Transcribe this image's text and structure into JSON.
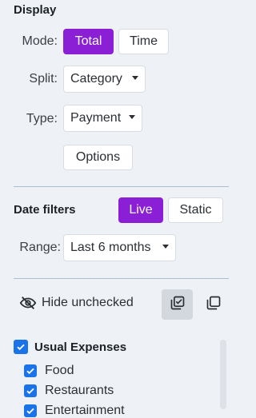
{
  "display": {
    "heading": "Display",
    "mode_label": "Mode:",
    "mode_options": [
      "Total",
      "Time"
    ],
    "mode_selected": "Total",
    "split_label": "Split:",
    "split_value": "Category",
    "type_label": "Type:",
    "type_value": "Payment",
    "options_button": "Options"
  },
  "date_filters": {
    "heading": "Date filters",
    "modes": [
      "Live",
      "Static"
    ],
    "selected": "Live",
    "range_label": "Range:",
    "range_value": "Last 6 months"
  },
  "toolbar": {
    "hide_unchecked_label": "Hide unchecked",
    "hide_icon": "eye-slash-icon",
    "check_all_icon": "stack-check-icon",
    "uncheck_all_icon": "stack-empty-icon"
  },
  "categories": {
    "group_label": "Usual Expenses",
    "items": [
      "Food",
      "Restaurants",
      "Entertainment"
    ]
  },
  "colors": {
    "accent": "#8a1fd6",
    "checkbox": "#1a73e8",
    "background": "#eef2f6"
  }
}
